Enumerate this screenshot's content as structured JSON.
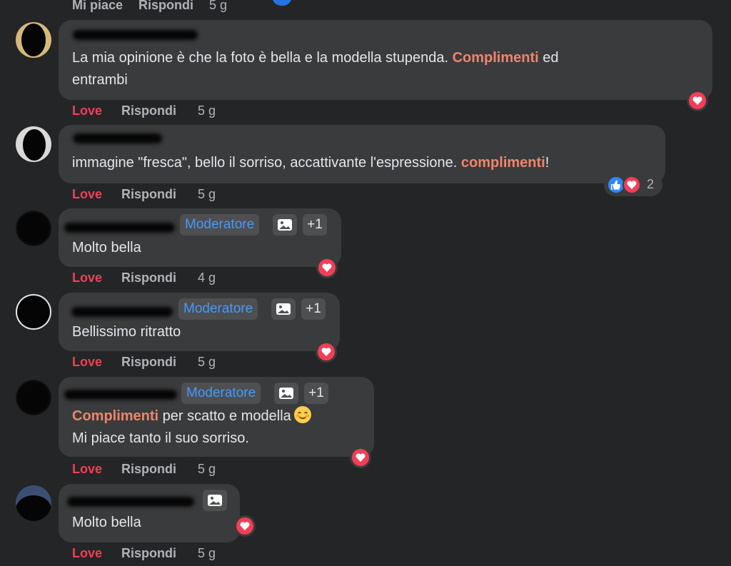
{
  "top": {
    "like_label": "Mi piace",
    "reply_label": "Rispondi",
    "time": "5 g"
  },
  "badges": {
    "moderator": "Moderatore",
    "plus_one": "+1"
  },
  "comments": [
    {
      "text_lines": [
        "La mia opinione è che la foto è bella e la modella stupenda. ",
        "Complimenti",
        " ed",
        "entrambi"
      ],
      "reaction": "heart",
      "love_label": "Love",
      "reply_label": "Rispondi",
      "time": "5 g"
    },
    {
      "text_lines": [
        "immagine \"fresca\", bello il sorriso, accattivante l'espressione. ",
        "complimenti",
        "!"
      ],
      "reaction": "like+heart",
      "reaction_count": "2",
      "love_label": "Love",
      "reply_label": "Rispondi",
      "time": "5 g"
    },
    {
      "text": "Molto bella",
      "reaction": "heart",
      "love_label": "Love",
      "reply_label": "Rispondi",
      "time": "4 g"
    },
    {
      "text": "Bellissimo ritratto",
      "reaction": "heart",
      "love_label": "Love",
      "reply_label": "Rispondi",
      "time": "5 g"
    },
    {
      "text_lines": [
        "Complimenti",
        " per scatto e modella",
        "Mi piace tanto il suo sorriso."
      ],
      "reaction": "heart",
      "love_label": "Love",
      "reply_label": "Rispondi",
      "time": "5 g"
    },
    {
      "text": "Molto bella",
      "reaction": "heart",
      "love_label": "Love",
      "reply_label": "Rispondi",
      "time": "5 g"
    }
  ],
  "colors": {
    "background": "#242526",
    "bubble": "#3a3b3c",
    "highlight": "#f0846c",
    "love": "#f33e58",
    "moderator": "#4599ff",
    "like": "#2e89ff"
  },
  "icons": {
    "badge_icon": "image-frame-icon",
    "heart": "heart-icon",
    "like": "thumbs-up-icon",
    "emoji": "smiling-face-icon"
  }
}
